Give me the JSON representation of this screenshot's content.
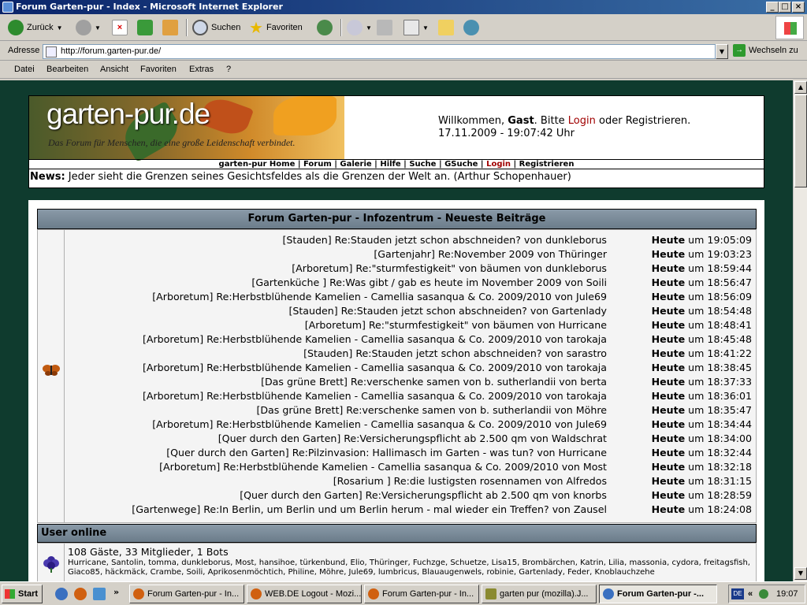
{
  "window": {
    "title": "Forum Garten-pur - Index - Microsoft Internet Explorer"
  },
  "toolbar": {
    "back": "Zurück",
    "search": "Suchen",
    "favorites": "Favoriten"
  },
  "address": {
    "label": "Adresse",
    "url": "http://forum.garten-pur.de/",
    "go": "Wechseln zu"
  },
  "menu": [
    "Datei",
    "Bearbeiten",
    "Ansicht",
    "Favoriten",
    "Extras",
    "?"
  ],
  "header": {
    "logo_text": "garten-pur.de",
    "slogan": "Das Forum für Menschen, die eine große Leidenschaft verbindet.",
    "welcome_prefix": "Willkommen, ",
    "guest": "Gast",
    "welcome_mid": ". Bitte ",
    "login": "Login",
    "welcome_or": " oder ",
    "register": "Registrieren.",
    "datetime": "17.11.2009 - 19:07:42 Uhr"
  },
  "nav": [
    "garten-pur Home",
    "Forum",
    "Galerie",
    "Hilfe",
    "Suche",
    "GSuche",
    "Login",
    "Registrieren"
  ],
  "news": {
    "label": "News:",
    "text": " Jeder sieht die Grenzen seines Gesichtsfeldes als die Grenzen der Welt an. (Arthur Schopenhauer)"
  },
  "forum": {
    "title": "Forum Garten-pur - Infozentrum - Neueste Beiträge",
    "posts": [
      {
        "text": "[Stauden] Re:Stauden jetzt schon abschneiden? von dunkleborus",
        "day": "Heute",
        "time": " um 19:05:09"
      },
      {
        "text": "[Gartenjahr] Re:November 2009 von Thüringer",
        "day": "Heute",
        "time": " um 19:03:23"
      },
      {
        "text": "[Arboretum] Re:\"sturmfestigkeit\" von bäumen von dunkleborus",
        "day": "Heute",
        "time": " um 18:59:44"
      },
      {
        "text": "[Gartenküche ] Re:Was gibt / gab es heute im November 2009 von Soili",
        "day": "Heute",
        "time": " um 18:56:47"
      },
      {
        "text": "[Arboretum] Re:Herbstblühende Kamelien - Camellia sasanqua & Co. 2009/2010 von Jule69",
        "day": "Heute",
        "time": " um 18:56:09"
      },
      {
        "text": "[Stauden] Re:Stauden jetzt schon abschneiden? von Gartenlady",
        "day": "Heute",
        "time": " um 18:54:48"
      },
      {
        "text": "[Arboretum] Re:\"sturmfestigkeit\" von bäumen von Hurricane",
        "day": "Heute",
        "time": " um 18:48:41"
      },
      {
        "text": "[Arboretum] Re:Herbstblühende Kamelien - Camellia sasanqua & Co. 2009/2010 von tarokaja",
        "day": "Heute",
        "time": " um 18:45:48"
      },
      {
        "text": "[Stauden] Re:Stauden jetzt schon abschneiden? von sarastro",
        "day": "Heute",
        "time": " um 18:41:22"
      },
      {
        "text": "[Arboretum] Re:Herbstblühende Kamelien - Camellia sasanqua & Co. 2009/2010 von tarokaja",
        "day": "Heute",
        "time": " um 18:38:45"
      },
      {
        "text": "[Das grüne Brett] Re:verschenke samen von b. sutherlandii von berta",
        "day": "Heute",
        "time": " um 18:37:33"
      },
      {
        "text": "[Arboretum] Re:Herbstblühende Kamelien - Camellia sasanqua & Co. 2009/2010 von tarokaja",
        "day": "Heute",
        "time": " um 18:36:01"
      },
      {
        "text": "[Das grüne Brett] Re:verschenke samen von b. sutherlandii von Möhre",
        "day": "Heute",
        "time": " um 18:35:47"
      },
      {
        "text": "[Arboretum] Re:Herbstblühende Kamelien - Camellia sasanqua & Co. 2009/2010 von Jule69",
        "day": "Heute",
        "time": " um 18:34:44"
      },
      {
        "text": "[Quer durch den Garten] Re:Versicherungspflicht ab 2.500 qm von Waldschrat",
        "day": "Heute",
        "time": " um 18:34:00"
      },
      {
        "text": "[Quer durch den Garten] Re:Pilzinvasion: Hallimasch im Garten - was tun? von Hurricane",
        "day": "Heute",
        "time": " um 18:32:44"
      },
      {
        "text": "[Arboretum] Re:Herbstblühende Kamelien - Camellia sasanqua & Co. 2009/2010 von Most",
        "day": "Heute",
        "time": " um 18:32:18"
      },
      {
        "text": "[Rosarium ] Re:die lustigsten rosennamen von Alfredos",
        "day": "Heute",
        "time": " um 18:31:15"
      },
      {
        "text": "[Quer durch den Garten] Re:Versicherungspflicht ab 2.500 qm von knorbs",
        "day": "Heute",
        "time": " um 18:28:59"
      },
      {
        "text": "[Gartenwege] Re:In Berlin, um Berlin und um Berlin herum - mal wieder ein Treffen? von Zausel",
        "day": "Heute",
        "time": " um 18:24:08"
      }
    ]
  },
  "users": {
    "title": "User online",
    "count": "108 Gäste, 33 Mitglieder, 1 Bots",
    "list": "Hurricane, Santolin, tomma, dunkleborus, Most, hansihoe, türkenbund, Elio, Thüringer, Fuchzge, Schuetze, Lisa15, Brombärchen, Katrin, Lilia, massonia, cydora, freitagsfish, Giaco85, häckmäck, Crambe, Soili, Aprikosenmöchtich, Philine, Möhre, Jule69, lumbricus, Blauaugenwels, robinie, Gartenlady, Feder, Knoblauchzehe"
  },
  "taskbar": {
    "start": "Start",
    "tasks": [
      "Forum Garten-pur - In...",
      "WEB.DE Logout - Mozi...",
      "Forum Garten-pur - In...",
      "garten pur (mozilla).J...",
      "Forum Garten-pur -..."
    ],
    "lang": "DE",
    "clock": "19:07"
  }
}
